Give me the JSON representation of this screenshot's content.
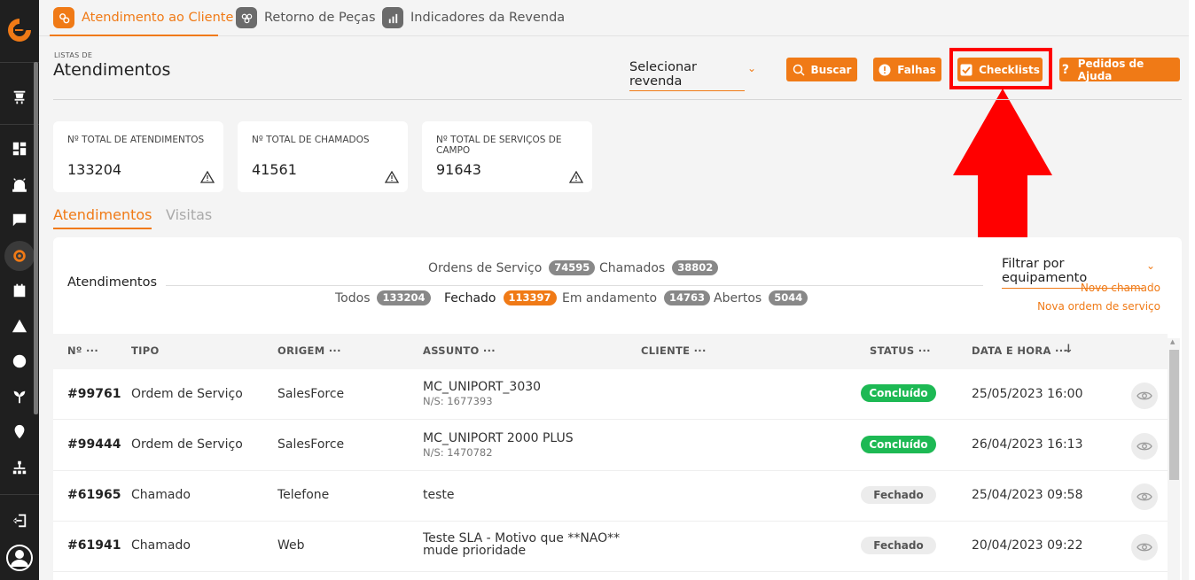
{
  "tabs": [
    {
      "label": "Atendimento ao Cliente"
    },
    {
      "label": "Retorno de Peças"
    },
    {
      "label": "Indicadores da Revenda"
    }
  ],
  "header": {
    "subtitle": "LISTAS DE",
    "title": "Atendimentos",
    "revenda": "Selecionar revenda",
    "buttons": {
      "buscar": "Buscar",
      "falhas": "Falhas",
      "checklists": "Checklists",
      "ajuda": "Pedidos de Ajuda"
    }
  },
  "cards": [
    {
      "label": "Nº TOTAL DE ATENDIMENTOS",
      "value": "133204"
    },
    {
      "label": "Nº TOTAL DE CHAMADOS",
      "value": "41561"
    },
    {
      "label": "Nº TOTAL DE SERVIÇOS DE CAMPO",
      "value": "91643"
    }
  ],
  "subtabs": [
    "Atendimentos",
    "Visitas"
  ],
  "panel": {
    "title": "Atendimentos",
    "type_filters": [
      {
        "label": "Ordens de Serviço",
        "count": "74595"
      },
      {
        "label": "Chamados",
        "count": "38802"
      }
    ],
    "status_filters": [
      {
        "label": "Todos",
        "count": "133204"
      },
      {
        "label": "Fechado",
        "count": "113397"
      },
      {
        "label": "Em andamento",
        "count": "14763"
      },
      {
        "label": "Abertos",
        "count": "5044"
      }
    ],
    "equip_filter": "Filtrar por equipamento",
    "new_ticket": "Novo chamado",
    "new_order": "Nova ordem de serviço"
  },
  "table": {
    "headers": [
      "Nº ···",
      "TIPO",
      "ORIGEM ···",
      "ASSUNTO ···",
      "CLIENTE ···",
      "STATUS ···",
      "DATA E HORA ···"
    ],
    "rows": [
      {
        "num": "#99761",
        "tipo": "Ordem de Serviço",
        "origem": "SalesForce",
        "assunto": "MC_UNIPORT_3030",
        "ns": "N/S: 1677393",
        "status": "Concluído",
        "data": "25/05/2023 16:00"
      },
      {
        "num": "#99444",
        "tipo": "Ordem de Serviço",
        "origem": "SalesForce",
        "assunto": "MC_UNIPORT 2000 PLUS",
        "ns": "N/S: 1470782",
        "status": "Concluído",
        "data": "26/04/2023 16:13"
      },
      {
        "num": "#61965",
        "tipo": "Chamado",
        "origem": "Telefone",
        "assunto": "teste",
        "ns": "",
        "status": "Fechado",
        "data": "25/04/2023 09:58"
      },
      {
        "num": "#61941",
        "tipo": "Chamado",
        "origem": "Web",
        "assunto": "Teste SLA - Motivo que **NAO**",
        "assunto2": "mude prioridade",
        "ns": "",
        "status": "Fechado",
        "data": "20/04/2023 09:22"
      }
    ]
  },
  "colors": {
    "accent": "#f07a16",
    "success": "#1db954",
    "sidebar": "#1f1f1f",
    "highlight": "#ff0000"
  }
}
